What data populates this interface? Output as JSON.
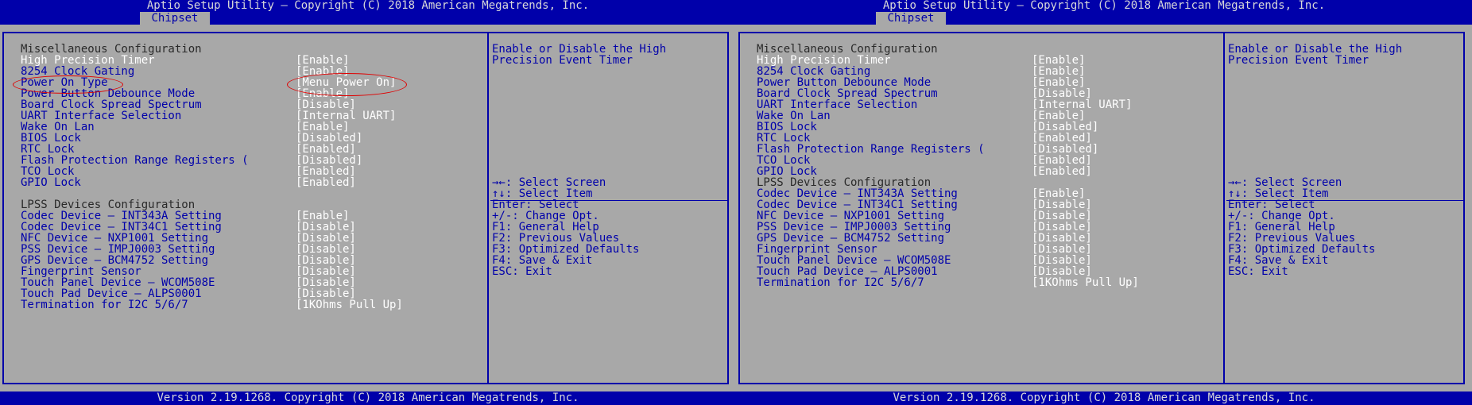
{
  "title": "Aptio Setup Utility – Copyright (C) 2018 American Megatrends, Inc.",
  "tab": "Chipset",
  "footer": "Version 2.19.1268. Copyright (C) 2018 American Megatrends, Inc.",
  "colors": {
    "background": "#0000aa",
    "panel": "#a8a8a8",
    "highlight": "#ffffff",
    "annotation": "#e00000"
  },
  "left": {
    "rows": [
      {
        "label": "Miscellaneous Configuration",
        "value": "",
        "header": true
      },
      {
        "label": "High Precision Timer",
        "value": "[Enable]",
        "selected": true
      },
      {
        "label": "8254 Clock Gating",
        "value": "[Enable]"
      },
      {
        "label": "Power On Type",
        "value": "[Menu Power On]"
      },
      {
        "label": "Power Button Debounce Mode",
        "value": "[Enable]"
      },
      {
        "label": "Board Clock Spread Spectrum",
        "value": "[Disable]"
      },
      {
        "label": "UART Interface Selection",
        "value": "[Internal UART]"
      },
      {
        "label": "Wake On Lan",
        "value": "[Enable]"
      },
      {
        "label": "BIOS Lock",
        "value": "[Disabled]"
      },
      {
        "label": "RTC Lock",
        "value": "[Enabled]"
      },
      {
        "label": "Flash Protection Range Registers (",
        "value": "[Disabled]"
      },
      {
        "label": "TCO Lock",
        "value": "[Enabled]"
      },
      {
        "label": "GPIO Lock",
        "value": "[Enabled]"
      },
      {
        "label": "",
        "value": ""
      },
      {
        "label": "LPSS Devices Configuration",
        "value": "",
        "header": true
      },
      {
        "label": "Codec Device – INT343A Setting",
        "value": "[Enable]"
      },
      {
        "label": "Codec Device – INT34C1 Setting",
        "value": "[Disable]"
      },
      {
        "label": "NFC Device – NXP1001 Setting",
        "value": "[Disable]"
      },
      {
        "label": "PSS Device – IMPJ0003 Setting",
        "value": "[Disable]"
      },
      {
        "label": "GPS Device – BCM4752 Setting",
        "value": "[Disable]"
      },
      {
        "label": "Fingerprint Sensor",
        "value": "[Disable]"
      },
      {
        "label": "Touch Panel Device – WCOM508E",
        "value": "[Disable]"
      },
      {
        "label": "Touch Pad Device – ALPS0001",
        "value": "[Disable]"
      },
      {
        "label": "Termination for I2C 5/6/7",
        "value": "[1KOhms Pull Up]"
      }
    ]
  },
  "right": {
    "rows": [
      {
        "label": "Miscellaneous Configuration",
        "value": "",
        "header": true
      },
      {
        "label": "High Precision Timer",
        "value": "[Enable]",
        "selected": true
      },
      {
        "label": "8254 Clock Gating",
        "value": "[Enable]"
      },
      {
        "label": "Power Button Debounce Mode",
        "value": "[Enable]"
      },
      {
        "label": "Board Clock Spread Spectrum",
        "value": "[Disable]"
      },
      {
        "label": "UART Interface Selection",
        "value": "[Internal UART]"
      },
      {
        "label": "Wake On Lan",
        "value": "[Enable]"
      },
      {
        "label": "BIOS Lock",
        "value": "[Disabled]"
      },
      {
        "label": "RTC Lock",
        "value": "[Enabled]"
      },
      {
        "label": "Flash Protection Range Registers (",
        "value": "[Disabled]"
      },
      {
        "label": "TCO Lock",
        "value": "[Enabled]"
      },
      {
        "label": "GPIO Lock",
        "value": "[Enabled]"
      },
      {
        "label": "LPSS Devices Configuration",
        "value": "",
        "header": true
      },
      {
        "label": "Codec Device – INT343A Setting",
        "value": "[Enable]"
      },
      {
        "label": "Codec Device – INT34C1 Setting",
        "value": "[Disable]"
      },
      {
        "label": "NFC Device – NXP1001 Setting",
        "value": "[Disable]"
      },
      {
        "label": "PSS Device – IMPJ0003 Setting",
        "value": "[Disable]"
      },
      {
        "label": "GPS Device – BCM4752 Setting",
        "value": "[Disable]"
      },
      {
        "label": "Fingerprint Sensor",
        "value": "[Disable]"
      },
      {
        "label": "Touch Panel Device – WCOM508E",
        "value": "[Disable]"
      },
      {
        "label": "Touch Pad Device – ALPS0001",
        "value": "[Disable]"
      },
      {
        "label": "Termination for I2C 5/6/7",
        "value": "[1KOhms Pull Up]"
      }
    ]
  },
  "help": [
    "Enable or Disable the High",
    "Precision Event Timer"
  ],
  "keys": [
    "→←: Select Screen",
    "↑↓: Select Item",
    "Enter: Select",
    "+/-: Change Opt.",
    "F1: General Help",
    "F2: Previous Values",
    "F3: Optimized Defaults",
    "F4: Save & Exit",
    "ESC: Exit"
  ]
}
